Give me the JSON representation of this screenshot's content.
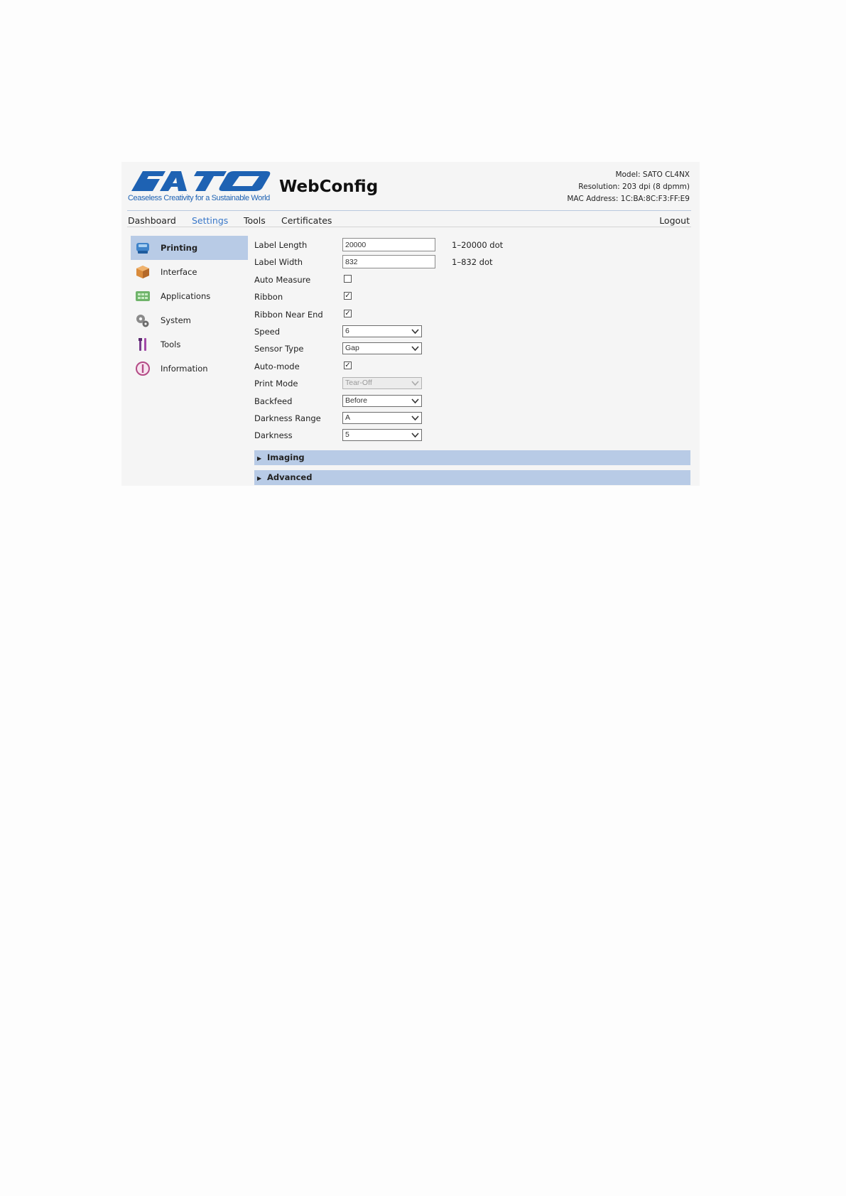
{
  "header": {
    "logo_tagline": "Ceaseless Creativity for a Sustainable World",
    "app_title": "WebConfig",
    "device": {
      "model": "Model: SATO CL4NX",
      "resolution": "Resolution: 203 dpi (8 dpmm)",
      "mac": "MAC Address: 1C:BA:8C:F3:FF:E9"
    }
  },
  "nav": {
    "items": [
      "Dashboard",
      "Settings",
      "Tools",
      "Certificates"
    ],
    "active": "Settings",
    "logout": "Logout"
  },
  "sidebar": {
    "items": [
      {
        "label": "Printing",
        "icon": "printer-icon"
      },
      {
        "label": "Interface",
        "icon": "interface-box-icon"
      },
      {
        "label": "Applications",
        "icon": "applications-grid-icon"
      },
      {
        "label": "System",
        "icon": "gears-icon"
      },
      {
        "label": "Tools",
        "icon": "tools-icon"
      },
      {
        "label": "Information",
        "icon": "information-icon"
      }
    ],
    "active": "Printing"
  },
  "form": {
    "label_length": {
      "label": "Label Length",
      "value": "20000",
      "hint": "1–20000 dot"
    },
    "label_width": {
      "label": "Label Width",
      "value": "832",
      "hint": "1–832 dot"
    },
    "auto_measure": {
      "label": "Auto Measure",
      "checked": false
    },
    "ribbon": {
      "label": "Ribbon",
      "checked": true
    },
    "ribbon_near_end": {
      "label": "Ribbon Near End",
      "checked": true
    },
    "speed": {
      "label": "Speed",
      "value": "6"
    },
    "sensor_type": {
      "label": "Sensor Type",
      "value": "Gap"
    },
    "auto_mode": {
      "label": "Auto-mode",
      "checked": true
    },
    "print_mode": {
      "label": "Print Mode",
      "value": "Tear-Off",
      "disabled": true
    },
    "backfeed": {
      "label": "Backfeed",
      "value": "Before"
    },
    "darkness_range": {
      "label": "Darkness Range",
      "value": "A"
    },
    "darkness": {
      "label": "Darkness",
      "value": "5"
    }
  },
  "sections": {
    "imaging": "Imaging",
    "advanced": "Advanced"
  },
  "colors": {
    "brand": "#1e62b3",
    "accent": "#3a78c9",
    "highlight": "#b8cbe6"
  }
}
